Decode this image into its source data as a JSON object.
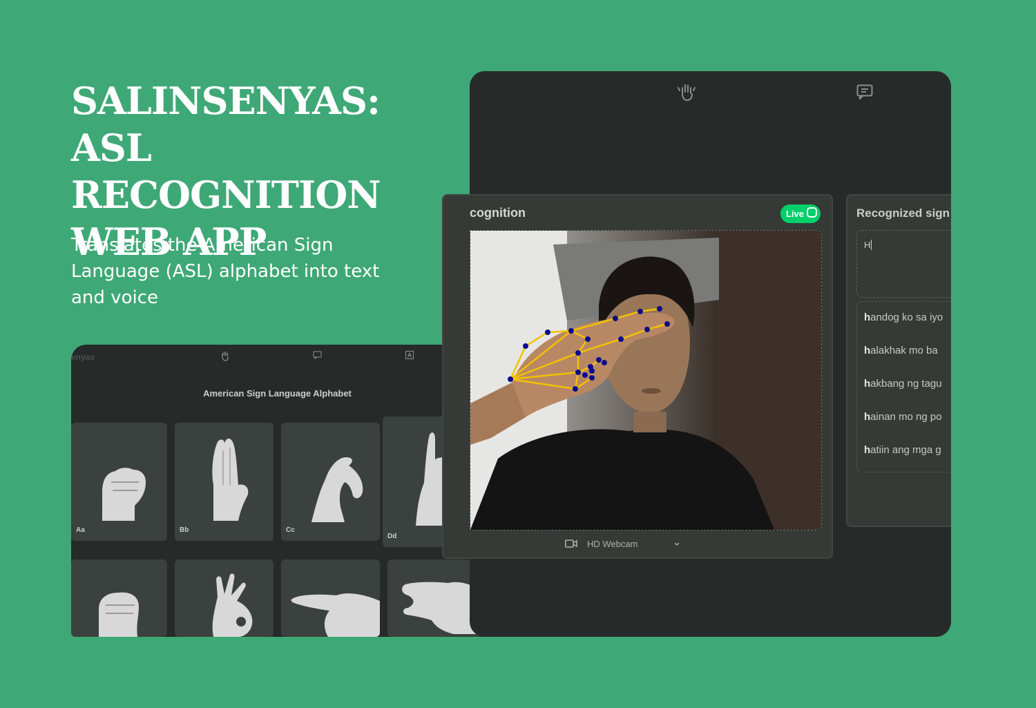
{
  "hero": {
    "title_line1": "SALINSENYAS:",
    "title_line2": "ASL RECOGNITION",
    "title_line3": "WEB APP",
    "subtitle": "Translates the American Sign Language (ASL) alphabet into text and voice"
  },
  "alphabet_screen": {
    "brand": "enyas",
    "nav_icons": [
      "hand-sign-icon",
      "chat-icon",
      "letter-a-icon"
    ],
    "title": "American Sign Language Alphabet",
    "cards": [
      {
        "label": "Aa"
      },
      {
        "label": "Bb"
      },
      {
        "label": "Cc"
      },
      {
        "label": "Dd"
      },
      {
        "label": ""
      },
      {
        "label": ""
      },
      {
        "label": ""
      },
      {
        "label": ""
      }
    ]
  },
  "recognition_screen": {
    "nav_icons": [
      "hand-sign-icon",
      "chat-icon"
    ],
    "panel_title": "cognition",
    "live_badge": "Live",
    "camera_select": "HD Webcam",
    "signs_title": "Recognized sign",
    "input_value": "H",
    "suggestions": [
      {
        "prefix": "h",
        "rest": "andog ko sa iyo"
      },
      {
        "prefix": "h",
        "rest": "alakhak mo ba"
      },
      {
        "prefix": "h",
        "rest": "akbang ng tagu"
      },
      {
        "prefix": "h",
        "rest": "ainan mo ng po"
      },
      {
        "prefix": "h",
        "rest": "atiin ang mga g"
      }
    ]
  },
  "colors": {
    "background": "#3fa877",
    "panel": "#262b29",
    "live_green": "#00d06a",
    "landmark_line": "#f2c200",
    "landmark_point": "#0b0b8c"
  }
}
